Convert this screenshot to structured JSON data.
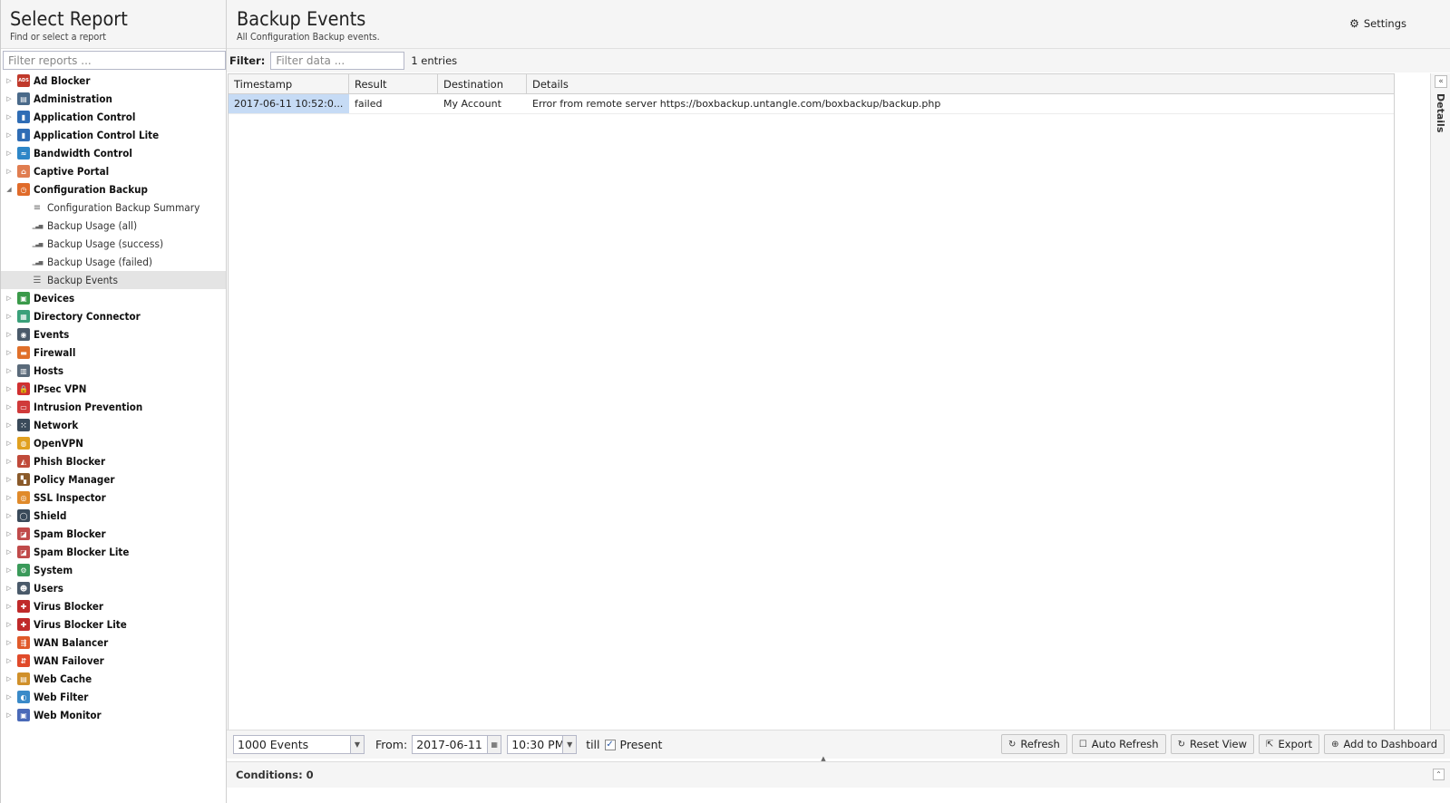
{
  "sidebar": {
    "title": "Select Report",
    "subtitle": "Find or select a report",
    "filter_placeholder": "Filter reports ...",
    "items": [
      {
        "label": "Ad Blocker",
        "icon": "ad-blocker-icon",
        "color": "#c0392b",
        "glyph": "ADS"
      },
      {
        "label": "Administration",
        "icon": "administration-icon",
        "color": "#4a6a8a",
        "glyph": "▤"
      },
      {
        "label": "Application Control",
        "icon": "application-control-icon",
        "color": "#2f6db5",
        "glyph": "▮"
      },
      {
        "label": "Application Control Lite",
        "icon": "application-control-lite-icon",
        "color": "#2f6db5",
        "glyph": "▮"
      },
      {
        "label": "Bandwidth Control",
        "icon": "bandwidth-control-icon",
        "color": "#2d86c7",
        "glyph": "≈"
      },
      {
        "label": "Captive Portal",
        "icon": "captive-portal-icon",
        "color": "#e07d50",
        "glyph": "⌂"
      },
      {
        "label": "Configuration Backup",
        "icon": "configuration-backup-icon",
        "color": "#e06b2a",
        "glyph": "◷",
        "expanded": true
      },
      {
        "label": "Devices",
        "icon": "devices-icon",
        "color": "#3a9a4a",
        "glyph": "▣"
      },
      {
        "label": "Directory Connector",
        "icon": "directory-connector-icon",
        "color": "#3aa07a",
        "glyph": "▦"
      },
      {
        "label": "Events",
        "icon": "events-icon",
        "color": "#4a5a6a",
        "glyph": "◉"
      },
      {
        "label": "Firewall",
        "icon": "firewall-icon",
        "color": "#e0702a",
        "glyph": "▬"
      },
      {
        "label": "Hosts",
        "icon": "hosts-icon",
        "color": "#5a6a7a",
        "glyph": "▥"
      },
      {
        "label": "IPsec VPN",
        "icon": "ipsec-vpn-icon",
        "color": "#d03030",
        "glyph": "🔒"
      },
      {
        "label": "Intrusion Prevention",
        "icon": "intrusion-prevention-icon",
        "color": "#d03a3a",
        "glyph": "▭"
      },
      {
        "label": "Network",
        "icon": "network-icon",
        "color": "#3a4a5a",
        "glyph": "⁙"
      },
      {
        "label": "OpenVPN",
        "icon": "openvpn-icon",
        "color": "#e0a020",
        "glyph": "◍"
      },
      {
        "label": "Phish Blocker",
        "icon": "phish-blocker-icon",
        "color": "#c04a3a",
        "glyph": "◭"
      },
      {
        "label": "Policy Manager",
        "icon": "policy-manager-icon",
        "color": "#8a5a2a",
        "glyph": "▚"
      },
      {
        "label": "SSL Inspector",
        "icon": "ssl-inspector-icon",
        "color": "#e08a2a",
        "glyph": "◎"
      },
      {
        "label": "Shield",
        "icon": "shield-icon",
        "color": "#3a4a5a",
        "glyph": "◯"
      },
      {
        "label": "Spam Blocker",
        "icon": "spam-blocker-icon",
        "color": "#c04a4a",
        "glyph": "◪"
      },
      {
        "label": "Spam Blocker Lite",
        "icon": "spam-blocker-lite-icon",
        "color": "#c04a4a",
        "glyph": "◪"
      },
      {
        "label": "System",
        "icon": "system-icon",
        "color": "#3a9a5a",
        "glyph": "⚙"
      },
      {
        "label": "Users",
        "icon": "users-icon",
        "color": "#4a5a6a",
        "glyph": "☻"
      },
      {
        "label": "Virus Blocker",
        "icon": "virus-blocker-icon",
        "color": "#c02a2a",
        "glyph": "✚"
      },
      {
        "label": "Virus Blocker Lite",
        "icon": "virus-blocker-lite-icon",
        "color": "#c02a2a",
        "glyph": "✚"
      },
      {
        "label": "WAN Balancer",
        "icon": "wan-balancer-icon",
        "color": "#e05a2a",
        "glyph": "⇶"
      },
      {
        "label": "WAN Failover",
        "icon": "wan-failover-icon",
        "color": "#e04a2a",
        "glyph": "⇵"
      },
      {
        "label": "Web Cache",
        "icon": "web-cache-icon",
        "color": "#d0902a",
        "glyph": "▤"
      },
      {
        "label": "Web Filter",
        "icon": "web-filter-icon",
        "color": "#3a8ac8",
        "glyph": "◐"
      },
      {
        "label": "Web Monitor",
        "icon": "web-monitor-icon",
        "color": "#4a6ab8",
        "glyph": "▣"
      }
    ],
    "children": [
      {
        "label": "Configuration Backup Summary",
        "icon": "text-report-icon",
        "glyph": "≡"
      },
      {
        "label": "Backup Usage (all)",
        "icon": "bar-chart-icon",
        "glyph": "▁▃▅"
      },
      {
        "label": "Backup Usage (success)",
        "icon": "bar-chart-icon",
        "glyph": "▁▃▅"
      },
      {
        "label": "Backup Usage (failed)",
        "icon": "bar-chart-icon",
        "glyph": "▁▃▅"
      },
      {
        "label": "Backup Events",
        "icon": "event-list-icon",
        "glyph": "☰",
        "selected": true
      }
    ]
  },
  "main": {
    "title": "Backup Events",
    "subtitle": "All Configuration Backup events.",
    "settings_label": "Settings",
    "filter_label": "Filter:",
    "filter_placeholder": "Filter data ...",
    "entries_count": "1 entries",
    "columns": [
      "Timestamp",
      "Result",
      "Destination",
      "Details"
    ],
    "rows": [
      [
        "2017-06-11 10:52:0...",
        "failed",
        "My Account",
        "Error from remote server https://boxbackup.untangle.com/boxbackup/backup.php"
      ]
    ],
    "details_label": "Details"
  },
  "bottom": {
    "events_limit": "1000 Events",
    "from_label": "From:",
    "from_date": "2017-06-11",
    "from_time": "10:30 PM",
    "till_label": "till",
    "present_label": "Present",
    "buttons": {
      "refresh": "Refresh",
      "auto_refresh": "Auto Refresh",
      "reset_view": "Reset View",
      "export": "Export",
      "add_to_dashboard": "Add to Dashboard"
    },
    "conditions_label": "Conditions: 0"
  }
}
